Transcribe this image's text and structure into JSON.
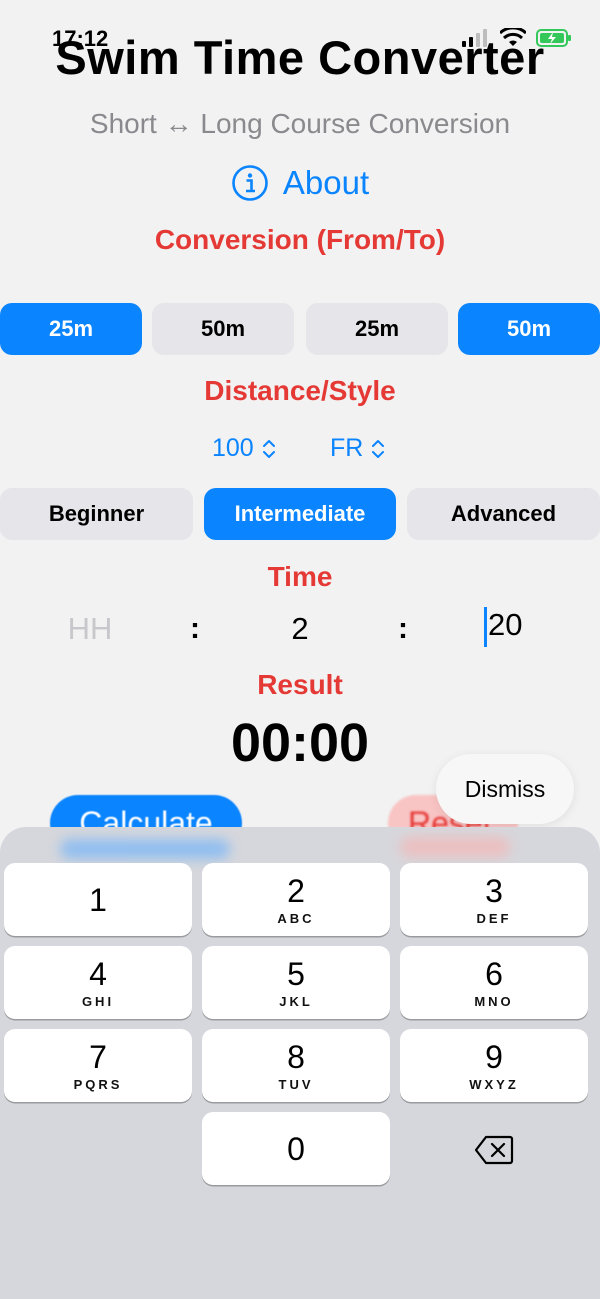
{
  "status": {
    "time": "17:12"
  },
  "header": {
    "title": "Swim Time Converter",
    "subtitle": "Short ↔ Long Course Conversion",
    "about_label": "About"
  },
  "conversion": {
    "heading": "Conversion (From/To)",
    "options": [
      {
        "label": "25m",
        "selected": true
      },
      {
        "label": "50m",
        "selected": false
      },
      {
        "label": "25m",
        "selected": false
      },
      {
        "label": "50m",
        "selected": true
      }
    ]
  },
  "distance_style": {
    "heading": "Distance/Style",
    "distance": "100",
    "style": "FR"
  },
  "level": {
    "options": [
      {
        "label": "Beginner",
        "selected": false
      },
      {
        "label": "Intermediate",
        "selected": true
      },
      {
        "label": "Advanced",
        "selected": false
      }
    ]
  },
  "time": {
    "heading": "Time",
    "hours_placeholder": "HH",
    "minutes": "2",
    "seconds": "20",
    "separator": ":"
  },
  "result": {
    "heading": "Result",
    "value": "00:00"
  },
  "actions": {
    "calculate_label": "Calculate",
    "reset_label": "Reset",
    "dismiss_label": "Dismiss"
  },
  "keypad": {
    "keys": [
      {
        "digit": "1",
        "letters": ""
      },
      {
        "digit": "2",
        "letters": "ABC"
      },
      {
        "digit": "3",
        "letters": "DEF"
      },
      {
        "digit": "4",
        "letters": "GHI"
      },
      {
        "digit": "5",
        "letters": "JKL"
      },
      {
        "digit": "6",
        "letters": "MNO"
      },
      {
        "digit": "7",
        "letters": "PQRS"
      },
      {
        "digit": "8",
        "letters": "TUV"
      },
      {
        "digit": "9",
        "letters": "WXYZ"
      },
      {
        "digit": "0",
        "letters": ""
      }
    ]
  },
  "colors": {
    "accent": "#0a84ff",
    "heading_red": "#e53935",
    "background": "#f2f2f2",
    "keyboard_bg": "#d6d7dc"
  }
}
